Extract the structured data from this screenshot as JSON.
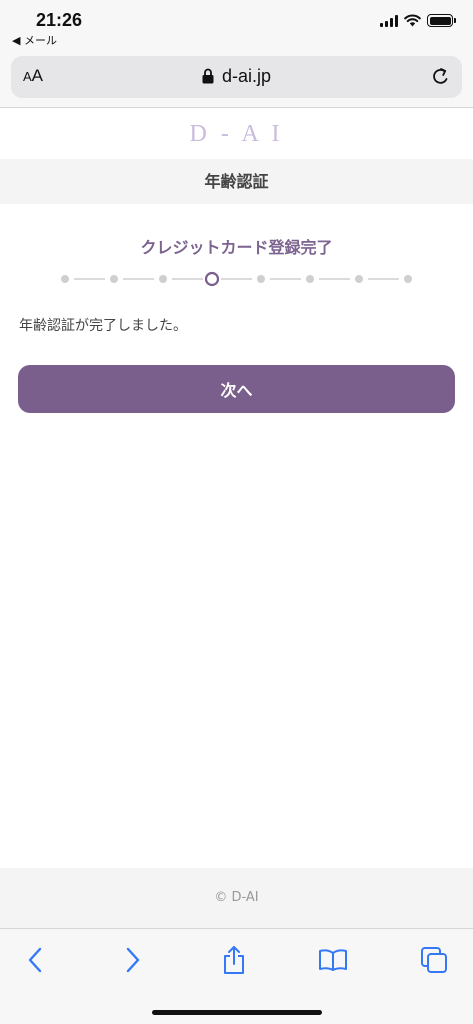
{
  "status_bar": {
    "time": "21:26",
    "back_app": "◀ メール",
    "icons": [
      "cellular-signal-icon",
      "wifi-icon",
      "battery-icon"
    ]
  },
  "browser": {
    "text_size_label_small": "A",
    "text_size_label_large": "A",
    "url": "d-ai.jp",
    "icons": [
      "lock-icon",
      "reload-icon"
    ]
  },
  "site": {
    "logo_text": "D - A I",
    "page_title": "年齢認証",
    "brand_color": "#7a5f8c"
  },
  "main": {
    "step_title": "クレジットカード登録完了",
    "progress": {
      "total_steps": 8,
      "current_step": 4
    },
    "message": "年齢認証が完了しました。",
    "next_label": "次へ"
  },
  "footer": {
    "copyright": "© D-AI"
  },
  "toolbar": {
    "icons": [
      "back-icon",
      "forward-icon",
      "share-icon",
      "bookmarks-icon",
      "tabs-icon"
    ]
  }
}
